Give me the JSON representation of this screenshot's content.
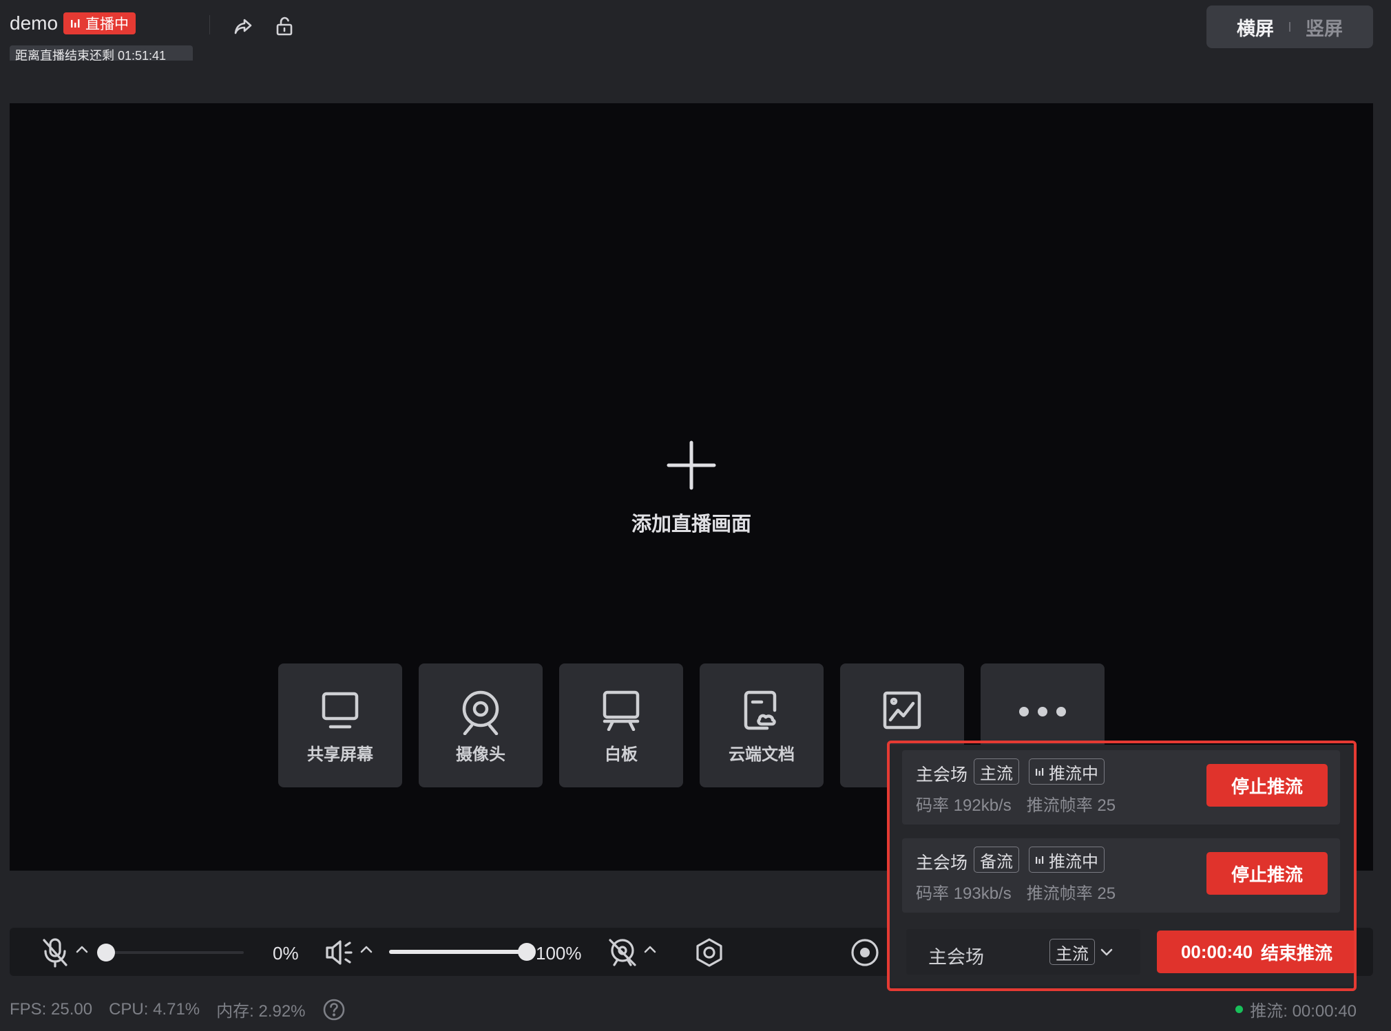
{
  "header": {
    "title": "demo",
    "live_badge": "直播中",
    "countdown": "距离直播结束还剩 01:51:41",
    "share_icon": "share-icon",
    "lock_icon": "unlock-icon"
  },
  "orientation": {
    "landscape": "横屏",
    "portrait": "竖屏",
    "selected": "landscape"
  },
  "stage": {
    "add_label": "添加直播画面",
    "sources": [
      {
        "label": "共享屏幕",
        "icon": "monitor-icon"
      },
      {
        "label": "摄像头",
        "icon": "webcam-icon"
      },
      {
        "label": "白板",
        "icon": "whiteboard-icon"
      },
      {
        "label": "云端文档",
        "icon": "cloud-doc-icon"
      },
      {
        "label": "",
        "icon": "image-icon"
      },
      {
        "label": "",
        "icon": "more-icon"
      }
    ]
  },
  "controls": {
    "mic_volume": "0%",
    "mic_level": 0,
    "speaker_volume": "100%",
    "speaker_level": 1.0,
    "icons": [
      "mic-muted-icon",
      "speaker-icon",
      "camera-off-icon",
      "settings-icon",
      "record-icon"
    ]
  },
  "streams": [
    {
      "venue": "主会场",
      "type": "主流",
      "state": "推流中",
      "bitrate": "码率 192kb/s",
      "fps": "推流帧率 25",
      "action": "停止推流"
    },
    {
      "venue": "主会场",
      "type": "备流",
      "state": "推流中",
      "bitrate": "码率 193kb/s",
      "fps": "推流帧率 25",
      "action": "停止推流"
    }
  ],
  "stream_select": {
    "venue": "主会场",
    "type": "主流"
  },
  "end_button": {
    "timer": "00:00:40",
    "label": "结束推流"
  },
  "status": {
    "fps": "FPS: 25.00",
    "cpu": "CPU: 4.71%",
    "memory": "内存: 2.92%",
    "push": "推流: 00:00:40"
  },
  "colors": {
    "accent_red": "#e0332c",
    "live_green": "#18c05a"
  }
}
